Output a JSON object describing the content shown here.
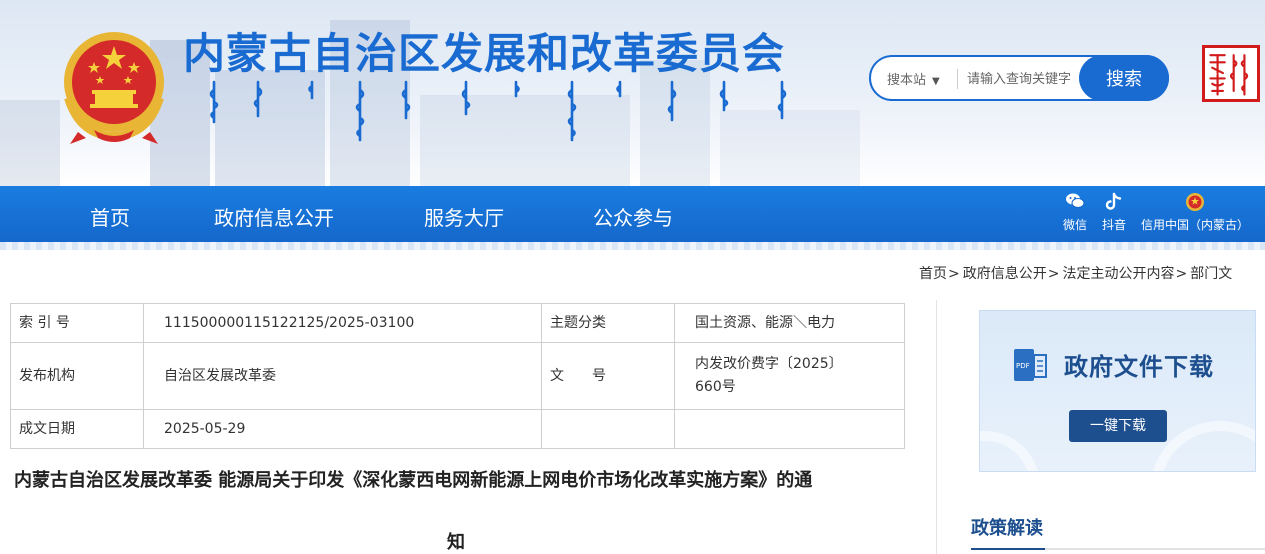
{
  "header": {
    "site_title": "内蒙古自治区发展和改革委员会",
    "emblem_icon": "national-emblem-icon",
    "mongolian_title_icon": "mongolian-script-title",
    "seal_icon": "inner-mongolia-seal-icon",
    "accent_color": "#1a6bd1"
  },
  "search": {
    "scope_label": "搜本站",
    "placeholder": "请输入查询关键字",
    "button_label": "搜索"
  },
  "nav": {
    "items": [
      {
        "label": "首页"
      },
      {
        "label": "政府信息公开"
      },
      {
        "label": "服务大厅"
      },
      {
        "label": "公众参与"
      }
    ],
    "tools": [
      {
        "label": "微信",
        "icon": "wechat-icon"
      },
      {
        "label": "抖音",
        "icon": "douyin-icon"
      },
      {
        "label": "信用中国（内蒙古）",
        "icon": "credit-china-icon"
      }
    ]
  },
  "breadcrumb": {
    "items": [
      "首页",
      "政府信息公开",
      "法定主动公开内容",
      "部门文"
    ],
    "separator": ">"
  },
  "meta": {
    "index_label": "索 引 号",
    "index_value": "111500000115122125/2025-03100",
    "topic_label": "主题分类",
    "topic_value": "国土资源、能源＼电力",
    "issuer_label": "发布机构",
    "issuer_value": "自治区发展改革委",
    "docno_label": "文　　号",
    "docno_value_line1": "内发改价费字〔2025〕",
    "docno_value_line2": "660号",
    "date_label": "成文日期",
    "date_value": "2025-05-29"
  },
  "document": {
    "title_line1": "内蒙古自治区发展改革委 能源局关于印发《深化蒙西电网新能源上网电价市场化改革实施方案》的通",
    "title_line2": "知"
  },
  "sidebar": {
    "download_title": "政府文件下载",
    "download_icon": "pdf-document-icon",
    "download_button": "一键下载",
    "policy_heading": "政策解读",
    "theme_color": "#1d4f8f"
  }
}
